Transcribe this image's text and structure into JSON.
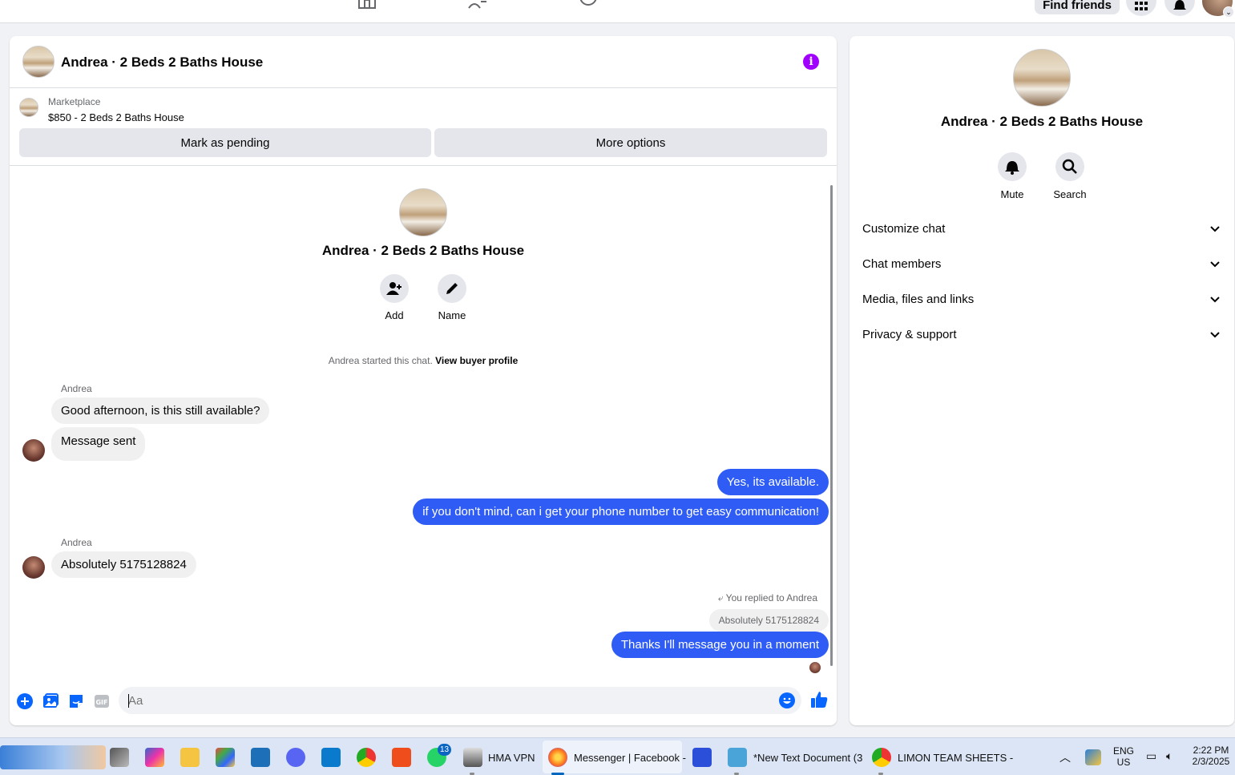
{
  "topnav": {
    "find_friends": "Find friends"
  },
  "chat": {
    "title": "Andrea · 2 Beds 2 Baths House",
    "marketplace": {
      "label": "Marketplace",
      "price_title": "$850 - 2 Beds 2 Baths House",
      "mark_pending": "Mark as pending",
      "more_options": "More options"
    },
    "intro": {
      "title": "Andrea · 2 Beds 2 Baths House",
      "add_label": "Add",
      "name_label": "Name",
      "started_text": "Andrea started this chat.",
      "view_profile": "View buyer profile"
    },
    "messages": [
      {
        "sender": "Andrea",
        "text": "Good afternoon, is this still available?"
      },
      {
        "text": "Message sent"
      },
      {
        "text": "Yes, its available."
      },
      {
        "text": "if you don't mind, can i get your phone number to get easy communication!"
      },
      {
        "sender": "Andrea",
        "text": "Absolutely 5175128824"
      },
      {
        "replied": "You replied to Andrea",
        "quoted": "Absolutely 5175128824",
        "text": "Thanks I'll message you in a moment"
      }
    ],
    "composer": {
      "placeholder": "Aa"
    }
  },
  "right_panel": {
    "title": "Andrea · 2 Beds 2 Baths House",
    "mute_label": "Mute",
    "search_label": "Search",
    "sections": [
      "Customize chat",
      "Chat members",
      "Media, files and links",
      "Privacy & support"
    ]
  },
  "taskbar": {
    "hma_label": "HMA VPN",
    "messenger_label": "Messenger | Facebook -",
    "notepad_label": "*New Text Document (3",
    "sheets_label": "LIMON TEAM SHEETS -",
    "whatsapp_badge": "13",
    "lang_top": "ENG",
    "lang_bottom": "US",
    "time": "2:22 PM",
    "date": "2/3/2025"
  },
  "colors": {
    "accent_blue": "#2e5cf5",
    "info_purple": "#a100ff",
    "facebook_blue": "#0866ff"
  }
}
